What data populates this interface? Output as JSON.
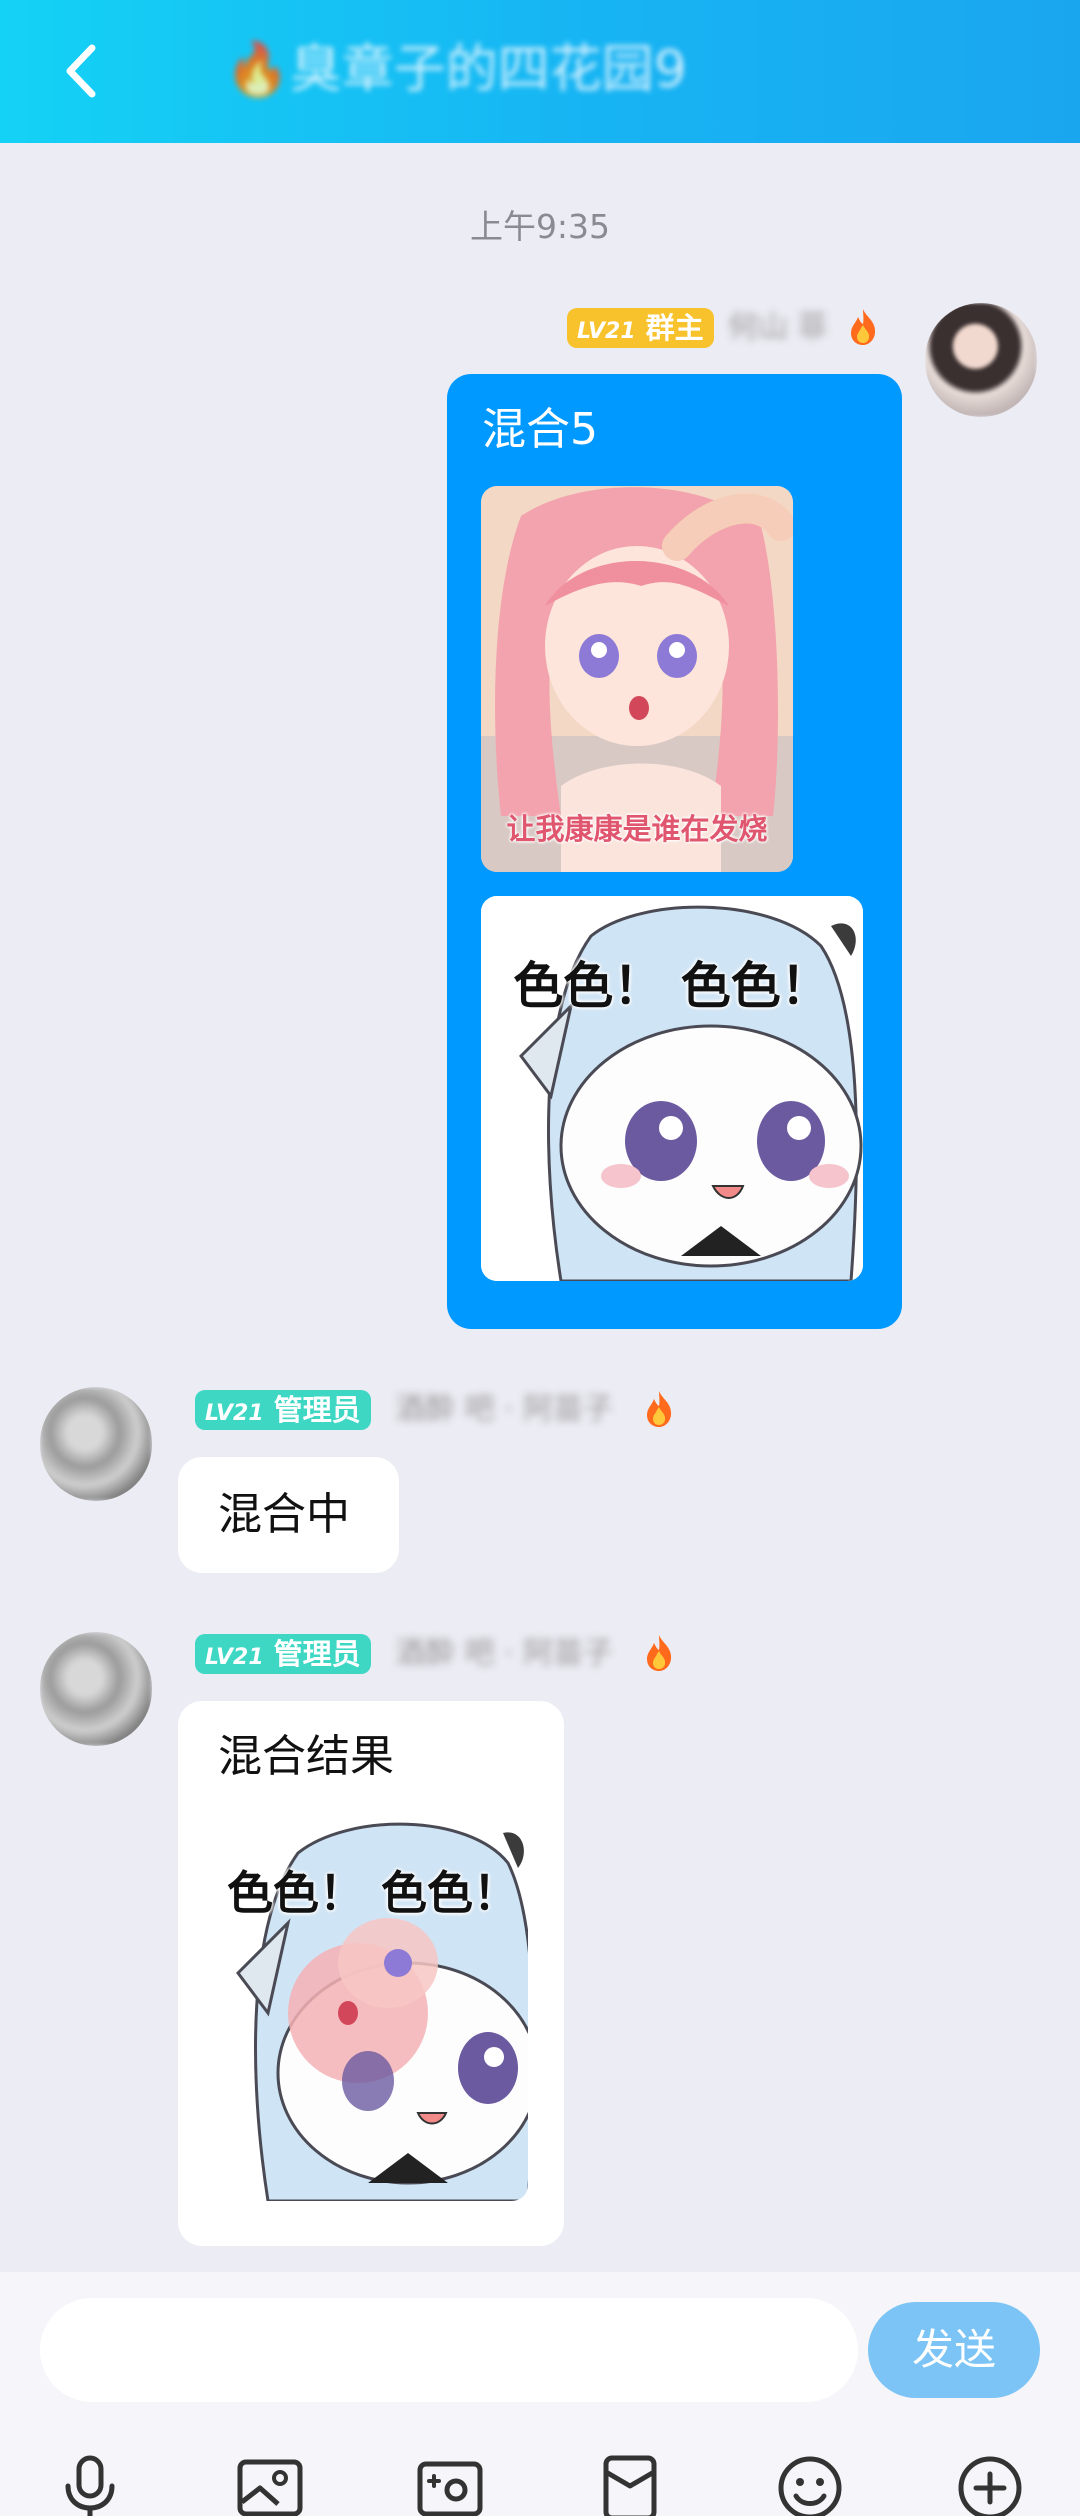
{
  "header": {
    "title": "🔥臭章子的四花园9"
  },
  "timestamp": "上午9:35",
  "messages": [
    {
      "sender": "self",
      "badge_level": "LV21",
      "badge_role": "群主",
      "nickname": "何山 菲",
      "bubble_text": "混合5",
      "sticker1_caption": "让我康康是谁在发烧",
      "sticker2_text": "色色！ 色色！"
    },
    {
      "sender": "other",
      "badge_level": "LV21",
      "badge_role": "管理员",
      "nickname": "酒酔 吧 · 阿苗子",
      "bubble_text": "混合中"
    },
    {
      "sender": "other",
      "badge_level": "LV21",
      "badge_role": "管理员",
      "nickname": "酒酔 吧 · 阿苗子",
      "bubble_text": "混合结果",
      "sticker_text": "色色！ 色色！"
    }
  ],
  "input": {
    "placeholder": "",
    "send_label": "发送"
  },
  "toolbar": [
    "microphone-icon",
    "image-icon",
    "camera-icon",
    "red-packet-icon",
    "emoji-icon",
    "plus-icon"
  ]
}
